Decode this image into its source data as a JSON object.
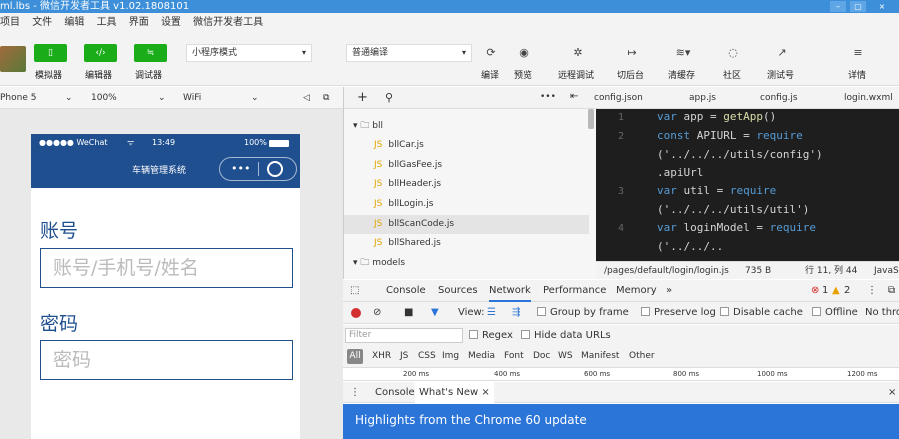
{
  "window": {
    "title": "ml.lbs - 微信开发者工具 v1.02.1808101",
    "min": "–",
    "max": "▢",
    "close": "×"
  },
  "menu": [
    "项目",
    "文件",
    "编辑",
    "工具",
    "界面",
    "设置",
    "微信开发者工具"
  ],
  "toolbar": {
    "simulator_label": "模拟器",
    "editor_label": "编辑器",
    "debugger_label": "调试器",
    "mode_value": "小程序模式",
    "compile_value": "普通编译",
    "actions": [
      "编译",
      "预览",
      "远程调试",
      "切后台",
      "清缓存",
      "社区",
      "测试号",
      "详情"
    ]
  },
  "device": {
    "model": "Phone 5",
    "zoom": "100%",
    "network": "WiFi"
  },
  "phone": {
    "carrier": "●●●●● WeChat",
    "time": "13:49",
    "battery": "100%",
    "nav_title": "车辆管理系统",
    "account_label": "账号",
    "account_placeholder": "账号/手机号/姓名",
    "password_label": "密码",
    "password_placeholder": "密码"
  },
  "filetree": [
    {
      "name": "bll",
      "type": "folder"
    },
    {
      "name": "bllCar.js",
      "type": "js"
    },
    {
      "name": "bllGasFee.js",
      "type": "js"
    },
    {
      "name": "bllHeader.js",
      "type": "js"
    },
    {
      "name": "bllLogin.js",
      "type": "js"
    },
    {
      "name": "bllScanCode.js",
      "type": "js",
      "selected": true
    },
    {
      "name": "bllShared.js",
      "type": "js"
    },
    {
      "name": "models",
      "type": "folder"
    }
  ],
  "editor_tabs": [
    "config.json",
    "app.js",
    "config.js",
    "login.wxml"
  ],
  "code": [
    {
      "ln": "1",
      "kw": "var",
      "rest": " app = ",
      "fn": "getApp",
      "tail": "()"
    },
    {
      "ln": "2",
      "kw": "const",
      "rest": " APIURL = ",
      "fn": "require",
      "tail": ""
    },
    {
      "ln": "",
      "str": "('../../../utils/config')"
    },
    {
      "ln": "",
      "plain": ".apiUrl"
    },
    {
      "ln": "3",
      "kw": "var",
      "rest": " util = ",
      "fn": "require",
      "tail": ""
    },
    {
      "ln": "",
      "str": "('../../../utils/util')"
    },
    {
      "ln": "4",
      "kw": "var",
      "rest": " loginModel = ",
      "fn": "require",
      "tail": ""
    },
    {
      "ln": "",
      "str": "('../../.."
    }
  ],
  "file_info": {
    "path": "/pages/default/login/login.js",
    "size": "735 B",
    "position": "行 11, 列 44",
    "lang": "JavaScript"
  },
  "devtools": {
    "tabs": [
      "Console",
      "Sources",
      "Network",
      "Performance",
      "Memory",
      "»"
    ],
    "active_tab": "Network",
    "errors": "1",
    "warnings": "2",
    "view_label": "View:",
    "group_by_frame": "Group by frame",
    "preserve_log": "Preserve log",
    "disable_cache": "Disable cache",
    "offline": "Offline",
    "throttling": "No throttling",
    "filter_placeholder": "Filter",
    "regex": "Regex",
    "hide_data_urls": "Hide data URLs",
    "types": [
      "All",
      "XHR",
      "JS",
      "CSS",
      "Img",
      "Media",
      "Font",
      "Doc",
      "WS",
      "Manifest",
      "Other"
    ],
    "timeline": [
      "200 ms",
      "400 ms",
      "600 ms",
      "800 ms",
      "1000 ms",
      "1200 ms"
    ],
    "drawer_tabs": [
      "Console",
      "What's New"
    ],
    "highlight": "Highlights from the Chrome 60 update"
  },
  "colors": {
    "brand_green": "#1aad19",
    "nav_blue": "#1f4f8f",
    "titlebar": "#3c8fd8",
    "highlight_blue": "#2b74d8"
  }
}
